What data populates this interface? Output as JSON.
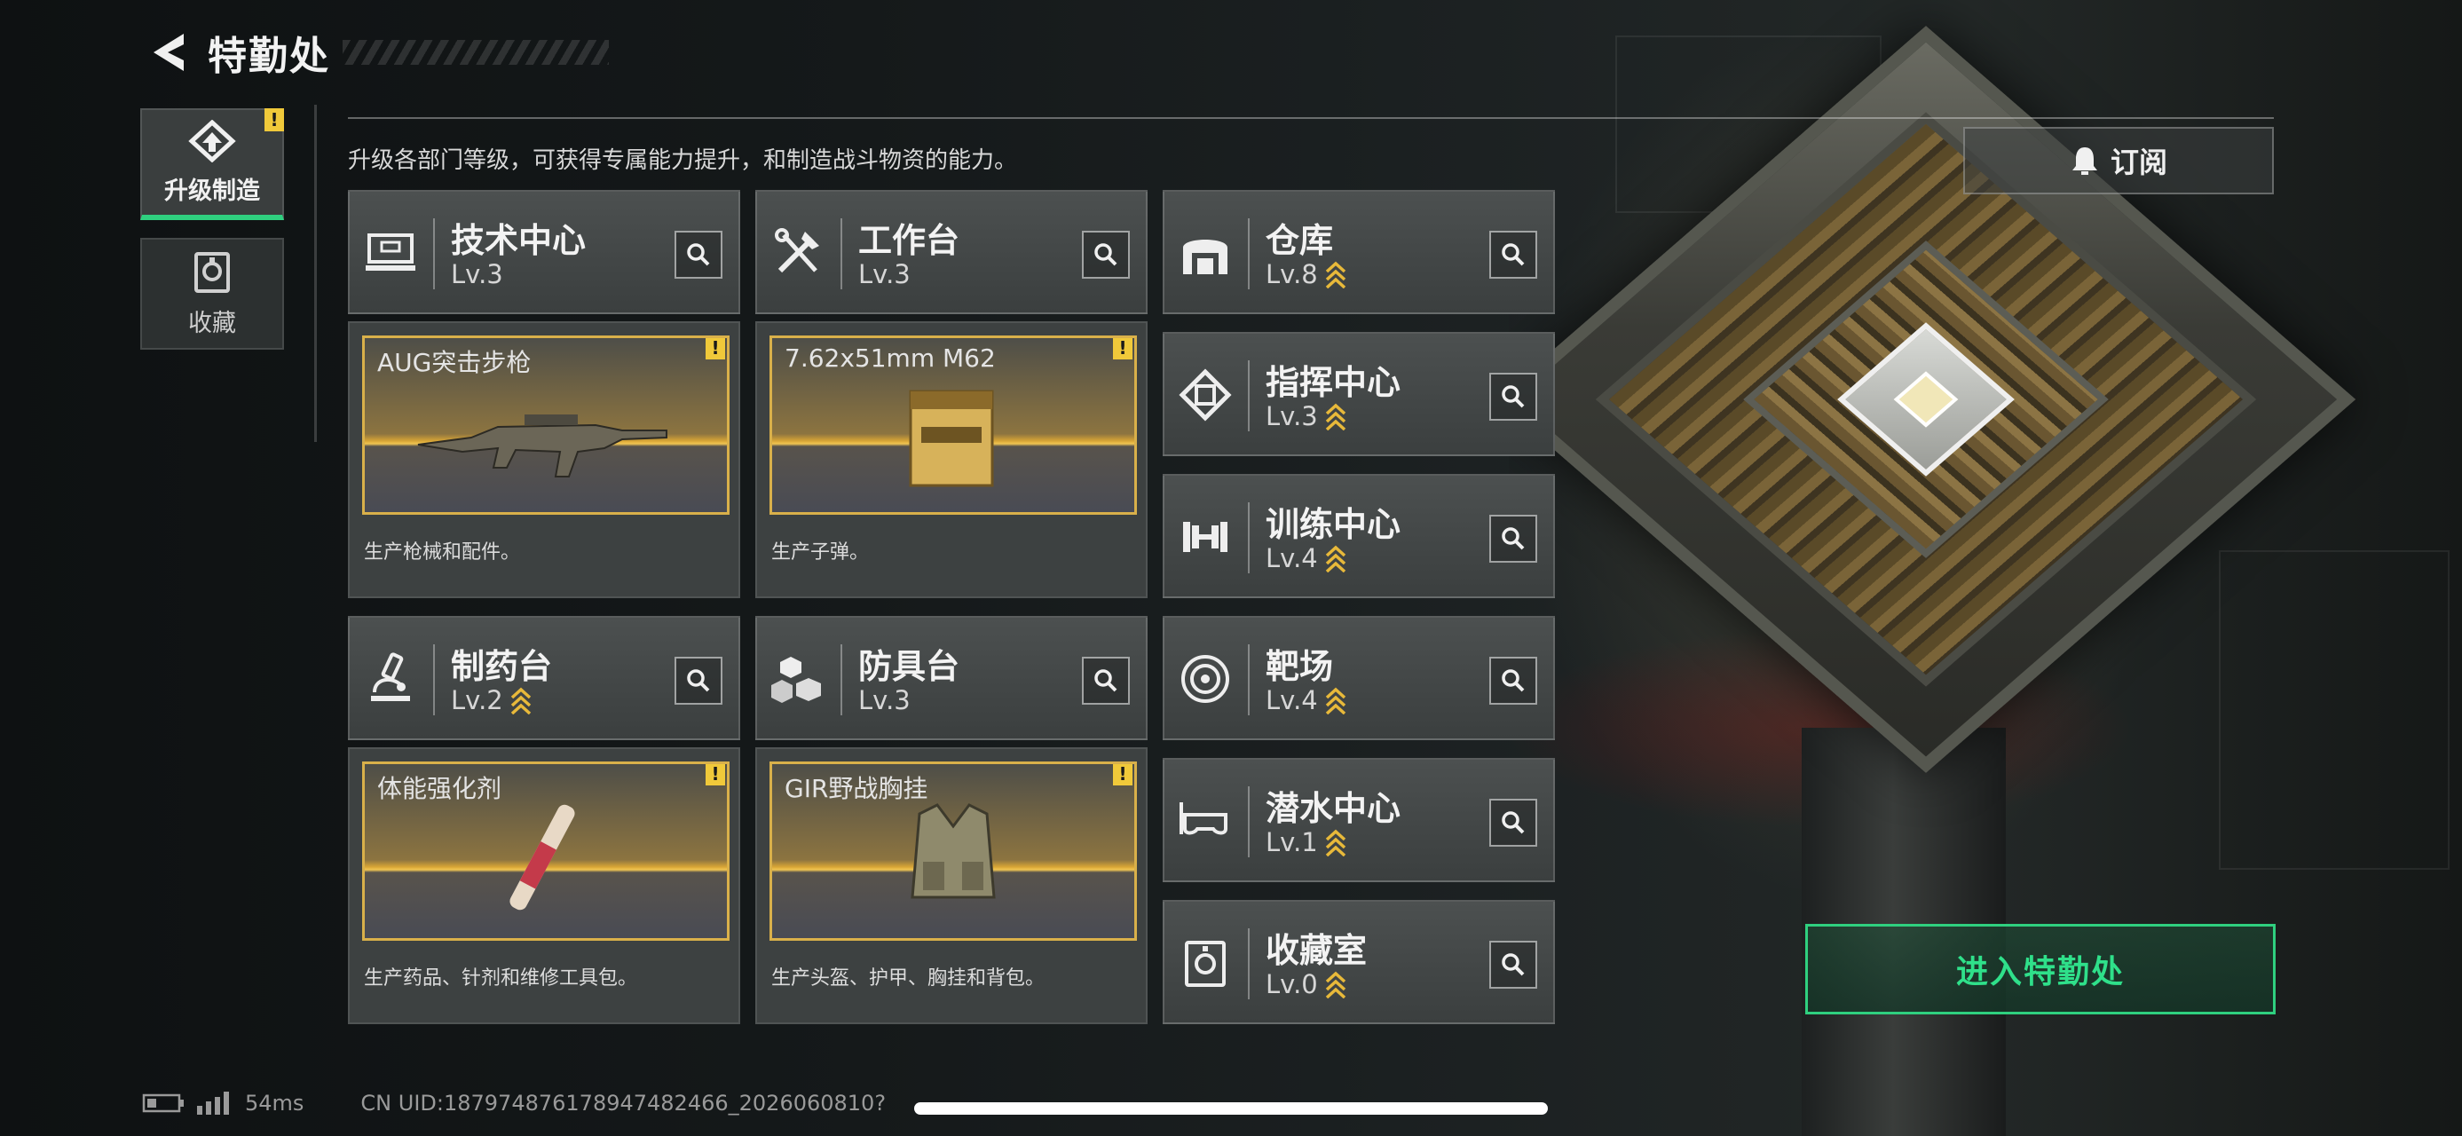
{
  "header": {
    "title": "特勤处",
    "back_icon": "back-arrow-icon"
  },
  "nav": [
    {
      "label": "升级制造",
      "icon": "upgrade-craft-icon",
      "active": true,
      "alert": "!"
    },
    {
      "label": "收藏",
      "icon": "collection-icon",
      "active": false
    }
  ],
  "description": "升级各部门等级，可获得专属能力提升，和制造战斗物资的能力。",
  "subscribe": {
    "label": "订阅",
    "icon": "bell-icon"
  },
  "stations": [
    {
      "name": "技术中心",
      "level": "Lv.3",
      "icon": "tech-center-icon",
      "upgradable": false
    },
    {
      "name": "工作台",
      "level": "Lv.3",
      "icon": "workbench-icon",
      "upgradable": false
    },
    {
      "name": "仓库",
      "level": "Lv.8",
      "icon": "warehouse-icon",
      "upgradable": true
    },
    {
      "name": "指挥中心",
      "level": "Lv.3",
      "icon": "command-center-icon",
      "upgradable": true
    },
    {
      "name": "训练中心",
      "level": "Lv.4",
      "icon": "training-center-icon",
      "upgradable": true
    },
    {
      "name": "制药台",
      "level": "Lv.2",
      "icon": "pharmacy-icon",
      "upgradable": true
    },
    {
      "name": "防具台",
      "level": "Lv.3",
      "icon": "armor-bench-icon",
      "upgradable": false
    },
    {
      "name": "靶场",
      "level": "Lv.4",
      "icon": "shooting-range-icon",
      "upgradable": true
    },
    {
      "name": "潜水中心",
      "level": "Lv.1",
      "icon": "diving-center-icon",
      "upgradable": true
    },
    {
      "name": "收藏室",
      "level": "Lv.0",
      "icon": "collection-room-icon",
      "upgradable": true
    }
  ],
  "productions": [
    {
      "item": "AUG突击步枪",
      "desc": "生产枪械和配件。",
      "alert": "!"
    },
    {
      "item": "7.62x51mm M62",
      "desc": "生产子弹。",
      "alert": "!"
    },
    {
      "item": "体能强化剂",
      "desc": "生产药品、针剂和维修工具包。",
      "alert": "!"
    },
    {
      "item": "GIR野战胸挂",
      "desc": "生产头盔、护甲、胸挂和背包。",
      "alert": "!"
    }
  ],
  "enter_button": "进入特勤处",
  "footer": {
    "ping": "54ms",
    "uid": "CN UID:187974876178947482466_2026060810?"
  },
  "colors": {
    "accent_green": "#2fd07f",
    "alert_yellow": "#f0c93a",
    "upgrade_gold": "#e8b93a"
  }
}
